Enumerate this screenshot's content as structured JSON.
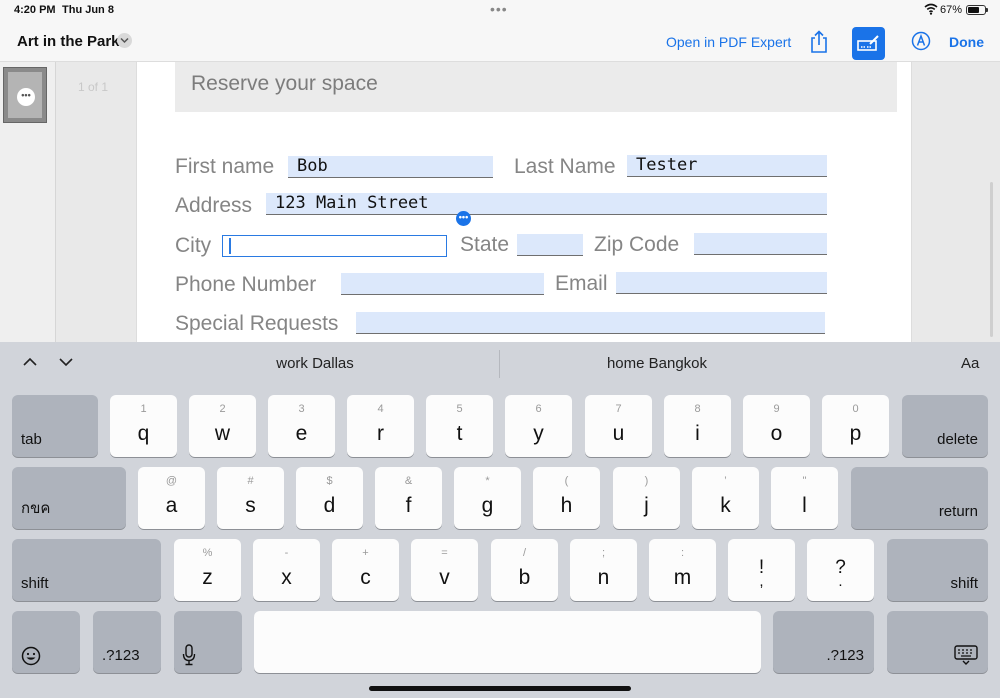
{
  "status_bar": {
    "time": "4:20 PM",
    "date": "Thu Jun 8",
    "battery_percent": "67%",
    "multitask_dots": "•••"
  },
  "nav": {
    "document_title": "Art in the Park",
    "open_in_app": "Open in PDF Expert",
    "done": "Done",
    "accent_color": "#1a73e8"
  },
  "viewer": {
    "page_indicator": "1 of 1",
    "thumbnail_menu": "•••"
  },
  "form": {
    "header": "Reserve your space",
    "first_name": {
      "label": "First name",
      "value": "Bob"
    },
    "last_name": {
      "label": "Last Name",
      "value": "Tester"
    },
    "address": {
      "label": "Address",
      "value": "123 Main Street"
    },
    "city": {
      "label": "City",
      "value": ""
    },
    "state": {
      "label": "State",
      "value": ""
    },
    "zip": {
      "label": "Zip Code",
      "value": ""
    },
    "phone": {
      "label": "Phone Number",
      "value": ""
    },
    "email": {
      "label": "Email",
      "value": ""
    },
    "special": {
      "label": "Special Requests",
      "value": ""
    },
    "field_menu": "•••"
  },
  "keyboard": {
    "suggestions": [
      "work Dallas",
      "home Bangkok"
    ],
    "format_button": "Aa",
    "row1": [
      {
        "hint": "1",
        "key": "q"
      },
      {
        "hint": "2",
        "key": "w"
      },
      {
        "hint": "3",
        "key": "e"
      },
      {
        "hint": "4",
        "key": "r"
      },
      {
        "hint": "5",
        "key": "t"
      },
      {
        "hint": "6",
        "key": "y"
      },
      {
        "hint": "7",
        "key": "u"
      },
      {
        "hint": "8",
        "key": "i"
      },
      {
        "hint": "9",
        "key": "o"
      },
      {
        "hint": "0",
        "key": "p"
      }
    ],
    "row2": [
      {
        "hint": "@",
        "key": "a"
      },
      {
        "hint": "#",
        "key": "s"
      },
      {
        "hint": "$",
        "key": "d"
      },
      {
        "hint": "&",
        "key": "f"
      },
      {
        "hint": "*",
        "key": "g"
      },
      {
        "hint": "(",
        "key": "h"
      },
      {
        "hint": ")",
        "key": "j"
      },
      {
        "hint": "’",
        "key": "k"
      },
      {
        "hint": "\"",
        "key": "l"
      }
    ],
    "row3": [
      {
        "hint": "%",
        "key": "z"
      },
      {
        "hint": "-",
        "key": "x"
      },
      {
        "hint": "+",
        "key": "c"
      },
      {
        "hint": "=",
        "key": "v"
      },
      {
        "hint": "/",
        "key": "b"
      },
      {
        "hint": ";",
        "key": "n"
      },
      {
        "hint": ":",
        "key": "m"
      }
    ],
    "punct1": {
      "top": "!",
      "bottom": ","
    },
    "punct2": {
      "top": "?",
      "bottom": "."
    },
    "tab": "tab",
    "delete": "delete",
    "lang": "กขค",
    "return": "return",
    "shift": "shift",
    "numbers": ".?123",
    "icons": [
      "emoji-icon",
      "microphone-icon",
      "keyboard-dismiss-icon"
    ]
  }
}
